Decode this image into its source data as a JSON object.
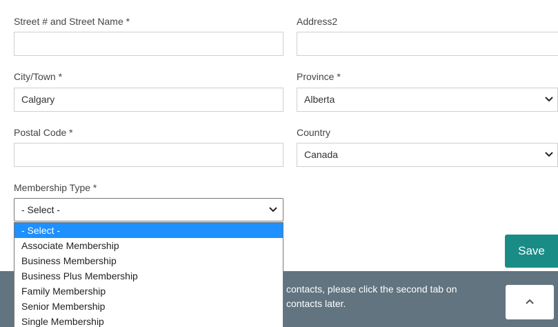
{
  "form": {
    "street": {
      "label": "Street # and Street Name *",
      "value": ""
    },
    "address2": {
      "label": "Address2",
      "value": ""
    },
    "city": {
      "label": "City/Town *",
      "value": "Calgary"
    },
    "province": {
      "label": "Province *",
      "value": "Alberta"
    },
    "postal": {
      "label": "Postal Code *",
      "value": ""
    },
    "country": {
      "label": "Country",
      "value": "Canada"
    },
    "membership": {
      "label": "Membership Type *",
      "value": "- Select -",
      "options": [
        "- Select -",
        "Associate Membership",
        "Business Membership",
        "Business Plus Membership",
        "Family Membership",
        "Senior Membership",
        "Single Membership"
      ],
      "highlighted_index": 0
    }
  },
  "actions": {
    "save_label": "Save"
  },
  "banner": {
    "line1": "contacts, please click the second tab on",
    "line2": "contacts later.",
    "scroll_top_icon": "chevron-up-icon"
  },
  "colors": {
    "accent": "#1a8c86",
    "banner": "#617480",
    "highlight": "#1e90ff"
  }
}
